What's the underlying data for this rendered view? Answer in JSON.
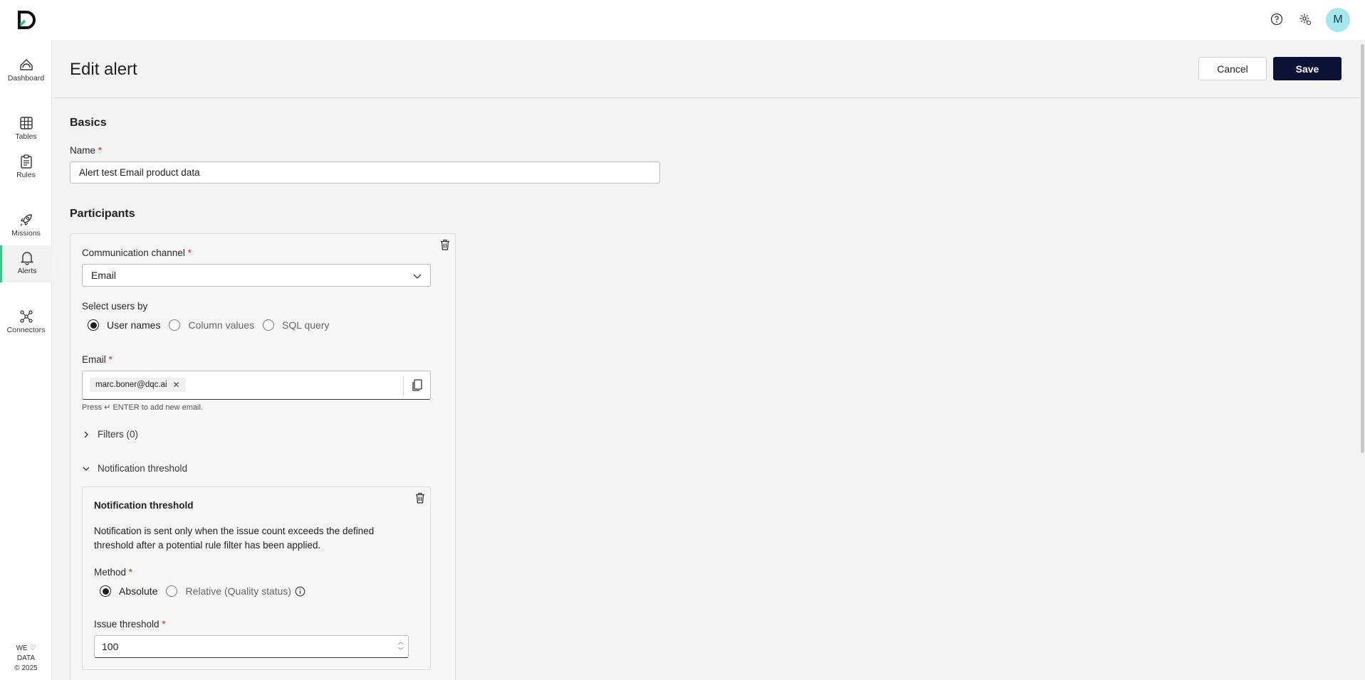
{
  "app": {
    "logo": "dqc-logo"
  },
  "topbar": {
    "help_icon": "help-icon",
    "settings_icon": "settings-icon",
    "avatar_initial": "M"
  },
  "sidebar": {
    "items": [
      {
        "label": "Dashboard",
        "icon": "dashboard-icon"
      },
      {
        "label": "Tables",
        "icon": "grid-icon"
      },
      {
        "label": "Rules",
        "icon": "clipboard-icon"
      },
      {
        "label": "Missions",
        "icon": "rocket-icon"
      },
      {
        "label": "Alerts",
        "icon": "bell-icon",
        "active": true
      },
      {
        "label": "Connectors",
        "icon": "connectors-icon"
      }
    ],
    "footer": {
      "line1": "WE",
      "line2": "DATA",
      "line3": "© 2025"
    }
  },
  "page": {
    "title": "Edit alert",
    "cancel_label": "Cancel",
    "save_label": "Save"
  },
  "basics": {
    "title": "Basics",
    "name_label": "Name",
    "required_mark": "*",
    "name_value": "Alert test Email product data"
  },
  "participants": {
    "title": "Participants",
    "channel_label": "Communication channel",
    "channel_value": "Email",
    "select_users_label": "Select users by",
    "select_users_options": [
      "User names",
      "Column values",
      "SQL query"
    ],
    "select_users_selected": "User names",
    "email_label": "Email",
    "email_chips": [
      "marc.boner@dqc.ai"
    ],
    "email_hint": "Press ↵ ENTER to add new email.",
    "filters_label": "Filters (0)",
    "threshold_label": "Notification threshold"
  },
  "threshold": {
    "title": "Notification threshold",
    "description": "Notification is sent only when the issue count exceeds the defined threshold after a potential rule filter has been applied.",
    "method_label": "Method",
    "method_options": [
      "Absolute",
      "Relative (Quality status)"
    ],
    "method_selected": "Absolute",
    "issue_label": "Issue threshold",
    "issue_value": "100"
  }
}
